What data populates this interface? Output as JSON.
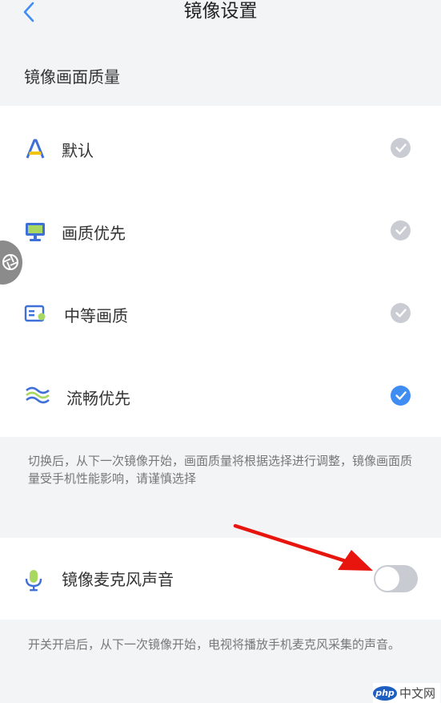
{
  "header": {
    "title": "镜像设置",
    "back_icon": "chevron-left-icon"
  },
  "quality_section": {
    "title": "镜像画面质量",
    "items": [
      {
        "label": "默认",
        "icon": "letter-a-icon",
        "selected": false
      },
      {
        "label": "画质优先",
        "icon": "monitor-icon",
        "selected": false
      },
      {
        "label": "中等画质",
        "icon": "card-icon",
        "selected": false
      },
      {
        "label": "流畅优先",
        "icon": "waves-icon",
        "selected": true
      }
    ],
    "note": "切换后，从下一次镜像开始，画面质量将根据选择进行调整，镜像画面质量受手机性能影响，请谨慎选择"
  },
  "mic_section": {
    "label": "镜像麦克风声音",
    "icon": "microphone-icon",
    "toggle_on": false,
    "note": "开关开启后，从下一次镜像开始，电视将播放手机麦克风采集的声音。"
  },
  "watermark": {
    "badge": "php",
    "text": "中文网"
  },
  "colors": {
    "accent": "#3f8cf3",
    "check_inactive": "#c9ccd2",
    "annotation": "#e8150f",
    "background": "#f3f4f6"
  }
}
